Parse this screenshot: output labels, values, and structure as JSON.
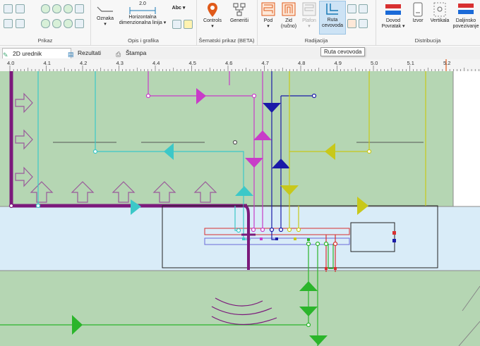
{
  "ribbon": {
    "groups": {
      "prikaz": "Prikaz",
      "opis": "Opis i grafika",
      "sematski": "Šematski prikaz (BETA)",
      "radijacija": "Radijacija",
      "distribucija": "Distribucija"
    },
    "buttons": {
      "oznaka": "Oznaka",
      "horizontalna": "Horizontalna",
      "dimenzionalna": "dimenzionalna linija",
      "dim_value": "2.0",
      "abc": "Abc",
      "controls": "Controls",
      "generisi": "Generiši",
      "pod": "Pod",
      "zid": "Zid",
      "zid_sub": "(ručno)",
      "plafon": "Plafon",
      "ruta": "Ruta",
      "cevovoda": "cevovoda",
      "dovod": "Dovod",
      "povratak": "Povratak",
      "izvor": "Izvor",
      "vertikala": "Vertikala",
      "daljinsko": "Daljinsko",
      "povezivanje": "povezivanje"
    }
  },
  "tabs": [
    {
      "label": "2D urednik",
      "icon": "pencil-icon"
    },
    {
      "label": "Rezultati",
      "icon": "results-icon"
    },
    {
      "label": "Štampa",
      "icon": "printer-icon"
    }
  ],
  "tooltip": "Ruta cevovoda",
  "ruler": [
    "4.0",
    "4.1",
    "4.2",
    "4.3",
    "4.4",
    "4.5",
    "4.6",
    "4.7",
    "4.8",
    "4.9",
    "5.0",
    "5.1",
    "5.2"
  ],
  "colors": {
    "ribbon_bg": "#f7f7f7",
    "room_green": "#b5d6b3",
    "room_blue": "#d9ecf8",
    "wall_purple": "#7b1a7b",
    "pipe_cyan": "#3cc8c8",
    "pipe_magenta": "#c83cc8",
    "pipe_navy": "#1a1aa8",
    "pipe_yellow": "#c8c81a",
    "pipe_green": "#2bb52b",
    "pipe_red": "#d83030",
    "accent_orange": "#e05a1a"
  }
}
